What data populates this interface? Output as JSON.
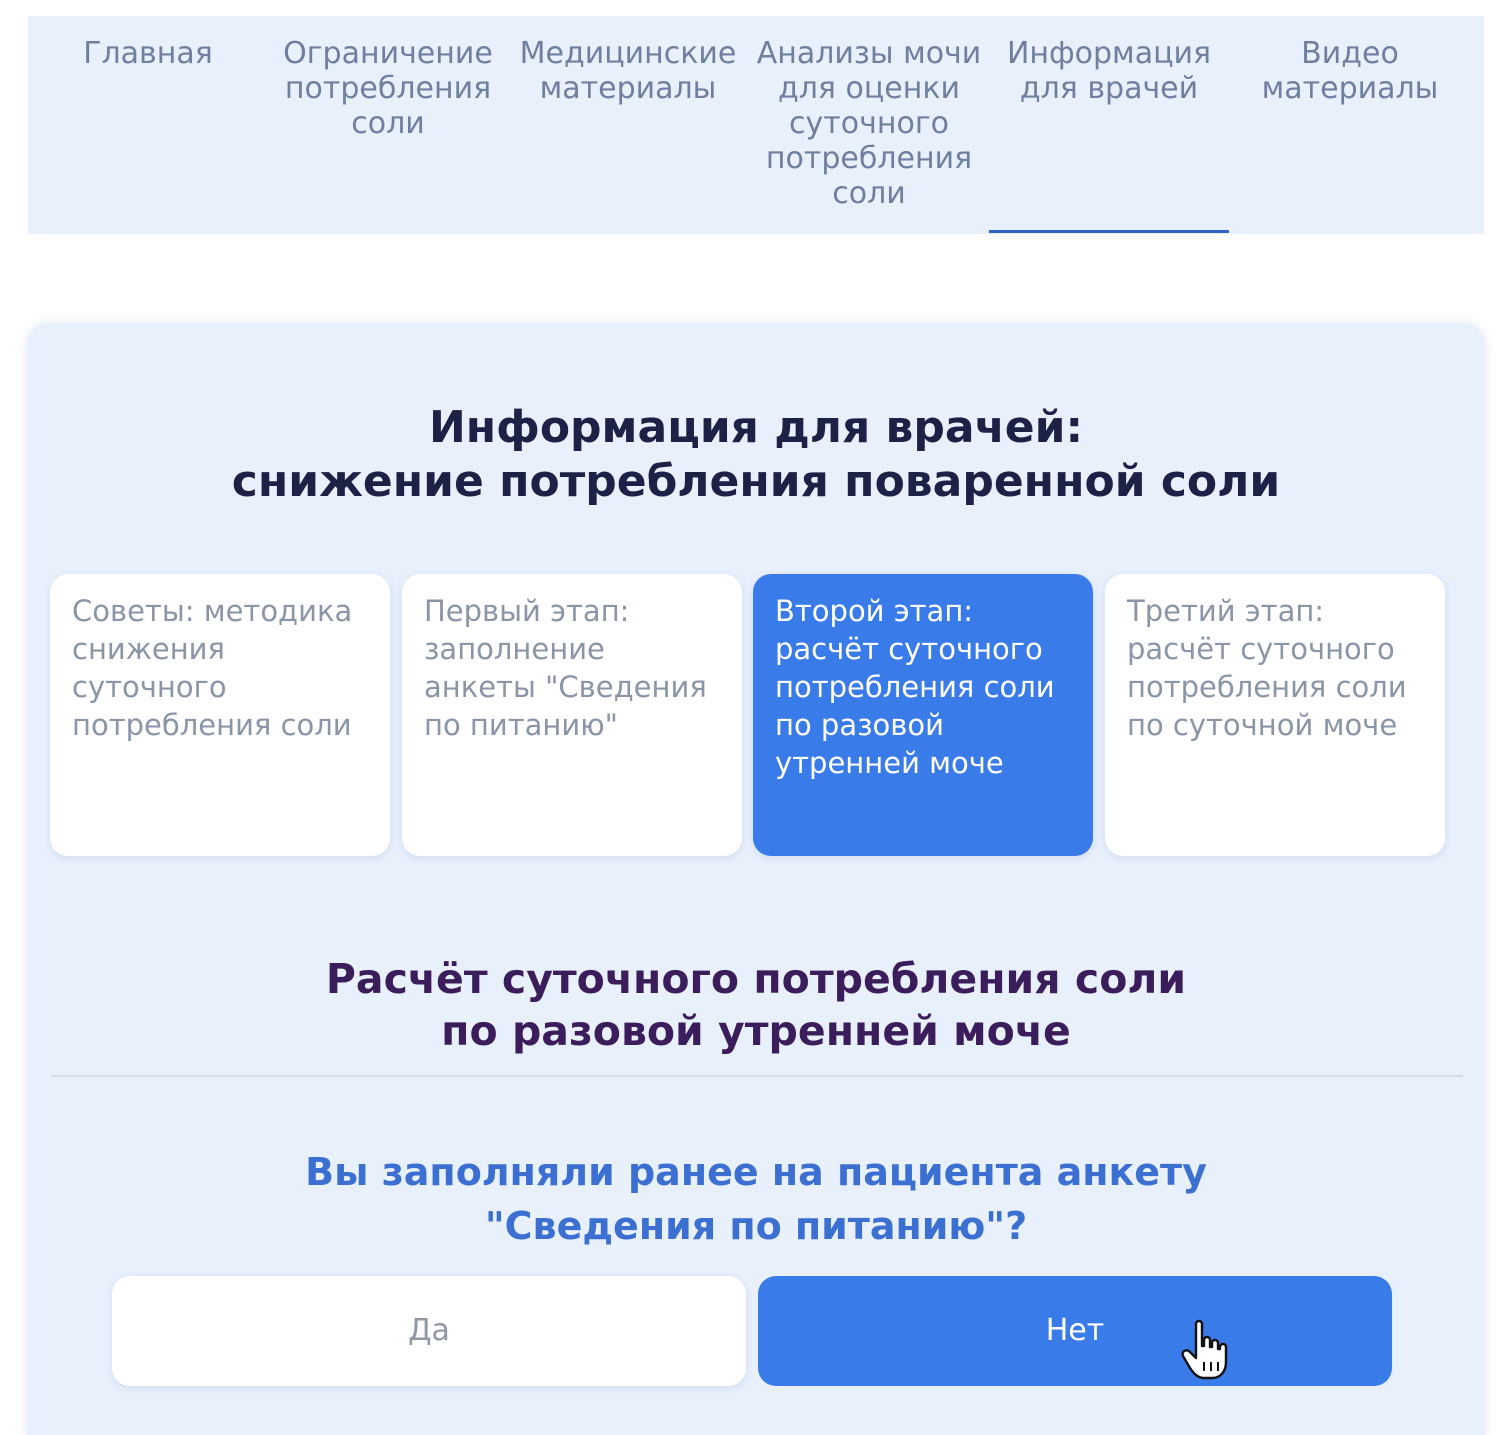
{
  "nav": {
    "tabs": [
      {
        "label": "Главная",
        "active": false
      },
      {
        "label": "Ограничение потребления соли",
        "active": false
      },
      {
        "label": "Медицинские материалы",
        "active": false
      },
      {
        "label": "Анализы мочи для оценки суточного потребления соли",
        "active": false
      },
      {
        "label": "Информация для врачей",
        "active": true
      },
      {
        "label": "Видео материалы",
        "active": false
      }
    ]
  },
  "card": {
    "title_line1": "Информация для врачей:",
    "title_line2": "снижение потребления поваренной соли",
    "steps": [
      {
        "label": "Советы: методика снижения суточного потребления соли",
        "active": false
      },
      {
        "label": "Первый этап: заполнение анкеты \"Сведения по питанию\"",
        "active": false
      },
      {
        "label": "Второй этап: расчёт суточного потребления соли по разовой утренней моче",
        "active": true
      },
      {
        "label": "Третий этап: расчёт суточного потребления соли по суточной моче",
        "active": false
      }
    ],
    "section_title_line1": "Расчёт суточного потребления соли",
    "section_title_line2": "по разовой утренней моче",
    "question_line1": "Вы заполняли ранее на пациента анкету",
    "question_line2": "\"Сведения по питанию\"?",
    "answers": {
      "yes": "Да",
      "no": "Нет",
      "selected": "no"
    }
  },
  "colors": {
    "accent": "#3a7bea",
    "panel_background": "#e8f0fc",
    "title": "#1c2146",
    "section_title": "#3a1d5a",
    "question": "#3c6fd2",
    "muted_text": "#6f7fa0"
  },
  "icons": {
    "cursor": "hand-pointer-icon"
  }
}
